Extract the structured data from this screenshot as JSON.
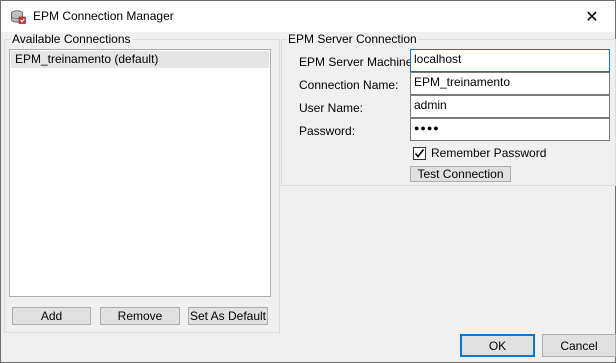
{
  "window": {
    "title": "EPM Connection Manager",
    "close_glyph": "✕",
    "icon": "epm-app-icon"
  },
  "connections": {
    "group_label": "Available Connections",
    "items": [
      "EPM_treinamento (default)"
    ],
    "selected_index": 0,
    "buttons": {
      "add": "Add",
      "remove": "Remove",
      "set_default": "Set As Default"
    }
  },
  "server": {
    "group_label": "EPM Server Connection",
    "fields": {
      "machine": {
        "label": "EPM Server Machine:",
        "value": "localhost"
      },
      "connection_name": {
        "label": "Connection Name:",
        "value": "EPM_treinamento"
      },
      "user_name": {
        "label": "User Name:",
        "value": "admin"
      },
      "password": {
        "label": "Password:",
        "value": "●●●●"
      }
    },
    "remember_password": {
      "label": "Remember Password",
      "checked": true
    },
    "test_button": "Test Connection"
  },
  "footer": {
    "ok": "OK",
    "cancel": "Cancel"
  },
  "colors": {
    "accent": "#0078d7",
    "background": "#f0f0f0",
    "selection": "#e5e5e5"
  }
}
